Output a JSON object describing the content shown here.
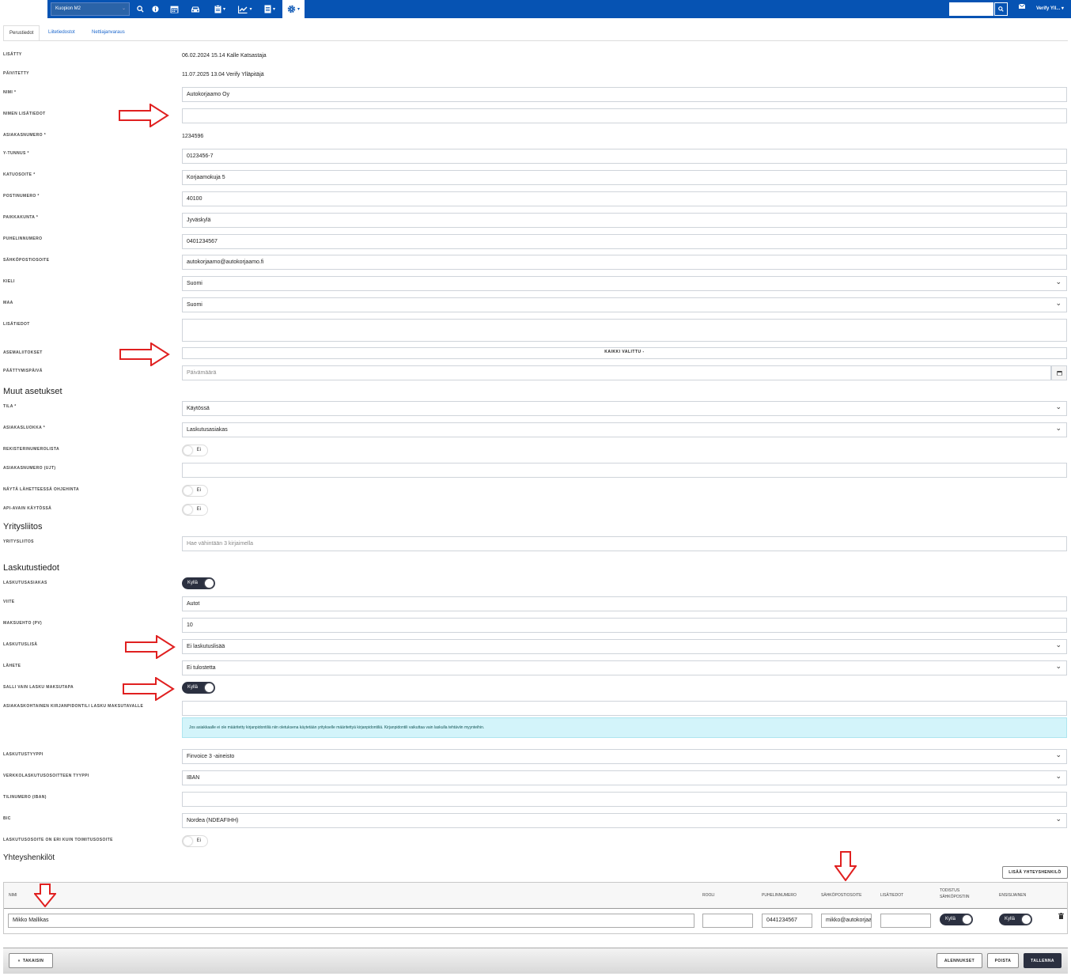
{
  "nav": {
    "station": "Kuopion M2",
    "user": "Verify Yll...",
    "icons": [
      "search-icon",
      "info-icon",
      "calendar-icon",
      "car-icon",
      "clipboard-icon",
      "chart-icon",
      "document-icon",
      "gear-icon"
    ]
  },
  "tabs": [
    "Perustiedot",
    "Liitetiedostot",
    "Nettiajanvaraus"
  ],
  "fields": {
    "lisatty_label": "LISÄTTY",
    "lisatty": "06.02.2024 15.14 Kalle Katsastaja",
    "paivitetty_label": "PÄIVITETTY",
    "paivitetty": "11.07.2025 13.04 Verify Ylläpitäjä",
    "nimi_label": "NIMI *",
    "nimi": "Autokorjaamo Oy",
    "nimen_lisatiedot_label": "NIMEN LISÄTIEDOT",
    "asiakasnumero_label": "ASIAKASNUMERO *",
    "asiakasnumero": "1234596",
    "ytunnus_label": "Y-TUNNUS *",
    "ytunnus": "0123456-7",
    "katuosoite_label": "KATUOSOITE *",
    "katuosoite": "Korjaamokuja 5",
    "postinumero_label": "POSTINUMERO *",
    "postinumero": "40100",
    "paikkakunta_label": "PAIKKAKUNTA *",
    "paikkakunta": "Jyväskylä",
    "puhelin_label": "PUHELINNUMERO",
    "puhelin": "0401234567",
    "email_label": "SÄHKÖPOSTIOSOITE",
    "email": "autokorjaamo@autokorjaamo.fi",
    "kieli_label": "KIELI",
    "kieli": "Suomi",
    "maa_label": "MAA",
    "maa": "Suomi",
    "lisatiedot_label": "LISÄTIEDOT",
    "asemaliitokset_label": "ASEMALIITOKSET",
    "asemaliitokset": "KAIKKI VALITTU  -",
    "paattymispaiva_label": "PÄÄTTYMISPÄIVÄ",
    "paattymispaiva_ph": "Päivämäärä"
  },
  "muut": {
    "title": "Muut asetukset",
    "tila_label": "TILA *",
    "tila": "Käytössä",
    "asiakasluokka_label": "ASIAKASLUOKKA *",
    "asiakasluokka": "Laskutusasiakas",
    "rekisteri_label": "REKISTERINUMEROLISTA",
    "rekisteri": "Ei",
    "ujt_label": "ASIAKASNUMERO (UJT)",
    "ohjehinta_label": "NÄYTÄ LÄHETTEESSÄ OHJEHINTA",
    "ohjehinta": "Ei",
    "api_label": "API-AVAIN KÄYTÖSSÄ",
    "api": "Ei"
  },
  "yritys": {
    "title": "Yritysliitos",
    "label": "YRITYSLIITOS",
    "ph": "Hae vähintään 3 kirjaimella"
  },
  "laskutus": {
    "title": "Laskutustiedot",
    "asiakas_label": "LASKUTUSASIAKAS",
    "asiakas": "Kyllä",
    "viite_label": "VIITE",
    "viite": "Autot",
    "maksuehto_label": "MAKSUEHTO (PV)",
    "maksuehto": "10",
    "lisa_label": "LASKUTUSLISÄ",
    "lisa": "Ei laskutuslisää",
    "lahete_label": "LÄHETE",
    "lahete": "Ei tulostetta",
    "salli_label": "SALLI VAIN LASKU MAKSUTAPA",
    "salli": "Kyllä",
    "kirjanpito_label": "ASIAKASKOHTAINEN KIRJANPIDONTILI LASKU MAKSUTAVALLE",
    "info": "Jos asiakkaalle ei ole määritetty kirjanpidontiliä niin oletuksena käytetään yritykselle määritettyä kirjanpidontiliä. Kirjanpidontili vaikuttaa vain laskulla tehtäviin myynteihin.",
    "tyyppi_label": "LASKUTUSTYYPPI",
    "tyyppi": "Finvoice 3 -aineisto",
    "verkko_label": "VERKKOLASKUTUSOSOITTEEN TYYPPI",
    "verkko": "IBAN",
    "iban_label": "TILINUMERO (IBAN)",
    "bic_label": "BIC",
    "bic": "Nordea (NDEAFIHH)",
    "eri_label": "LASKUTUSOSOITE ON ERI KUIN TOIMITUSOSOITE",
    "eri": "Ei"
  },
  "yhteys": {
    "title": "Yhteyshenkilöt",
    "add": "LISÄÄ YHTEYSHENKILÖ",
    "headers": [
      "NIMI",
      "ROOLI",
      "PUHELINNUMERO",
      "SÄHKÖPOSTIOSOITE",
      "LISÄTIEDOT",
      "TODISTUS SÄHKÖPOSTIIN",
      "ENSISIJAINEN"
    ],
    "row": {
      "nimi": "Mikko Mallikas",
      "rooli": "",
      "puhelin": "0441234567",
      "email": "mikko@autokorjaamo.fi",
      "lisatiedot": "",
      "todistus": "Kyllä",
      "ensisijainen": "Kyllä"
    }
  },
  "footer": {
    "back": "TAKAISIN",
    "alennukset": "ALENNUKSET",
    "poista": "POISTA",
    "tallenna": "TALLENNA"
  }
}
